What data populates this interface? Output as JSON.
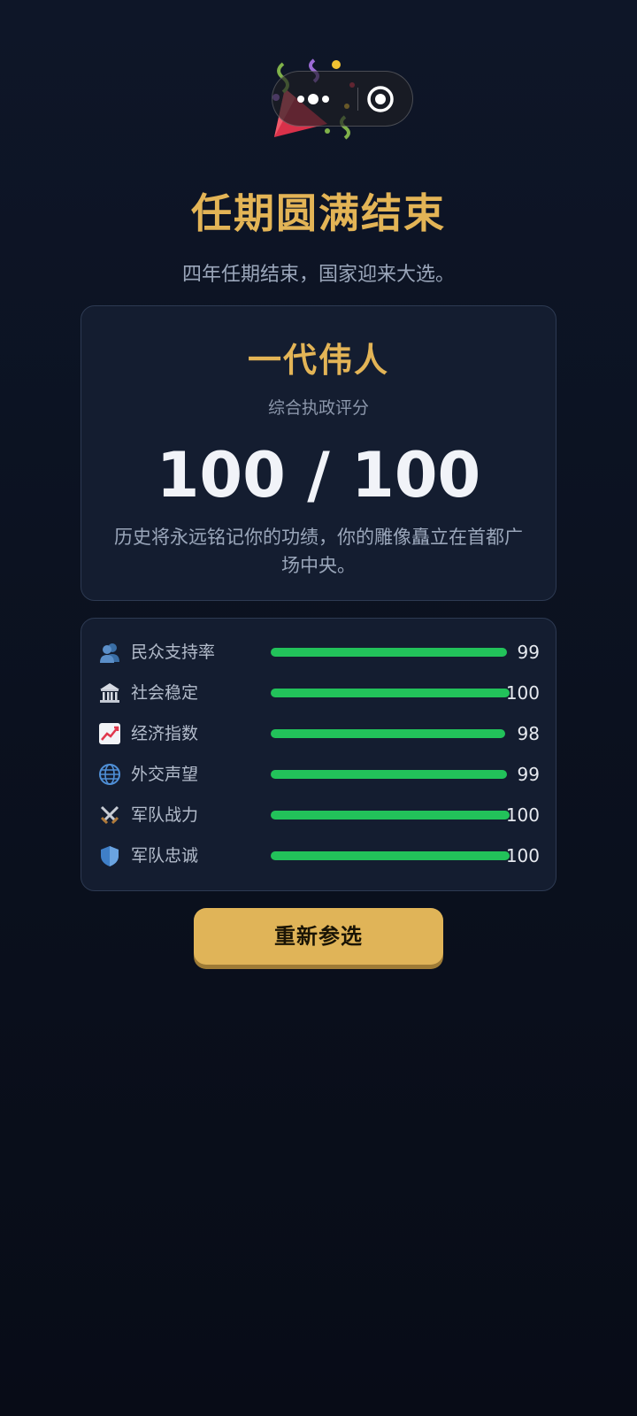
{
  "header": {
    "party_icon": "party-popper-icon",
    "title": "任期圆满结束",
    "subtitle": "四年任期结束，国家迎来大选。"
  },
  "capsule": {
    "more_icon": "more-dots-icon",
    "close_icon": "target-circle-icon"
  },
  "score_card": {
    "rank": "一代伟人",
    "label": "综合执政评分",
    "score": "100 / 100",
    "description": "历史将永远铭记你的功绩，你的雕像矗立在首都广场中央。"
  },
  "stats": [
    {
      "icon": "people-icon",
      "label": "民众支持率",
      "value": "99",
      "level": 0.99
    },
    {
      "icon": "institution-icon",
      "label": "社会稳定",
      "value": "100",
      "level": 1.0
    },
    {
      "icon": "chart-up-icon",
      "label": "经济指数",
      "value": "98",
      "level": 0.98
    },
    {
      "icon": "globe-icon",
      "label": "外交声望",
      "value": "99",
      "level": 0.99
    },
    {
      "icon": "crossed-swords-icon",
      "label": "军队战力",
      "value": "100",
      "level": 1.0
    },
    {
      "icon": "shield-icon",
      "label": "军队忠诚",
      "value": "100",
      "level": 1.0
    }
  ],
  "colors": {
    "accent": "#e3b456",
    "bar": "#22c25a",
    "background": "#0b111f"
  },
  "actions": {
    "restart_label": "重新参选"
  }
}
